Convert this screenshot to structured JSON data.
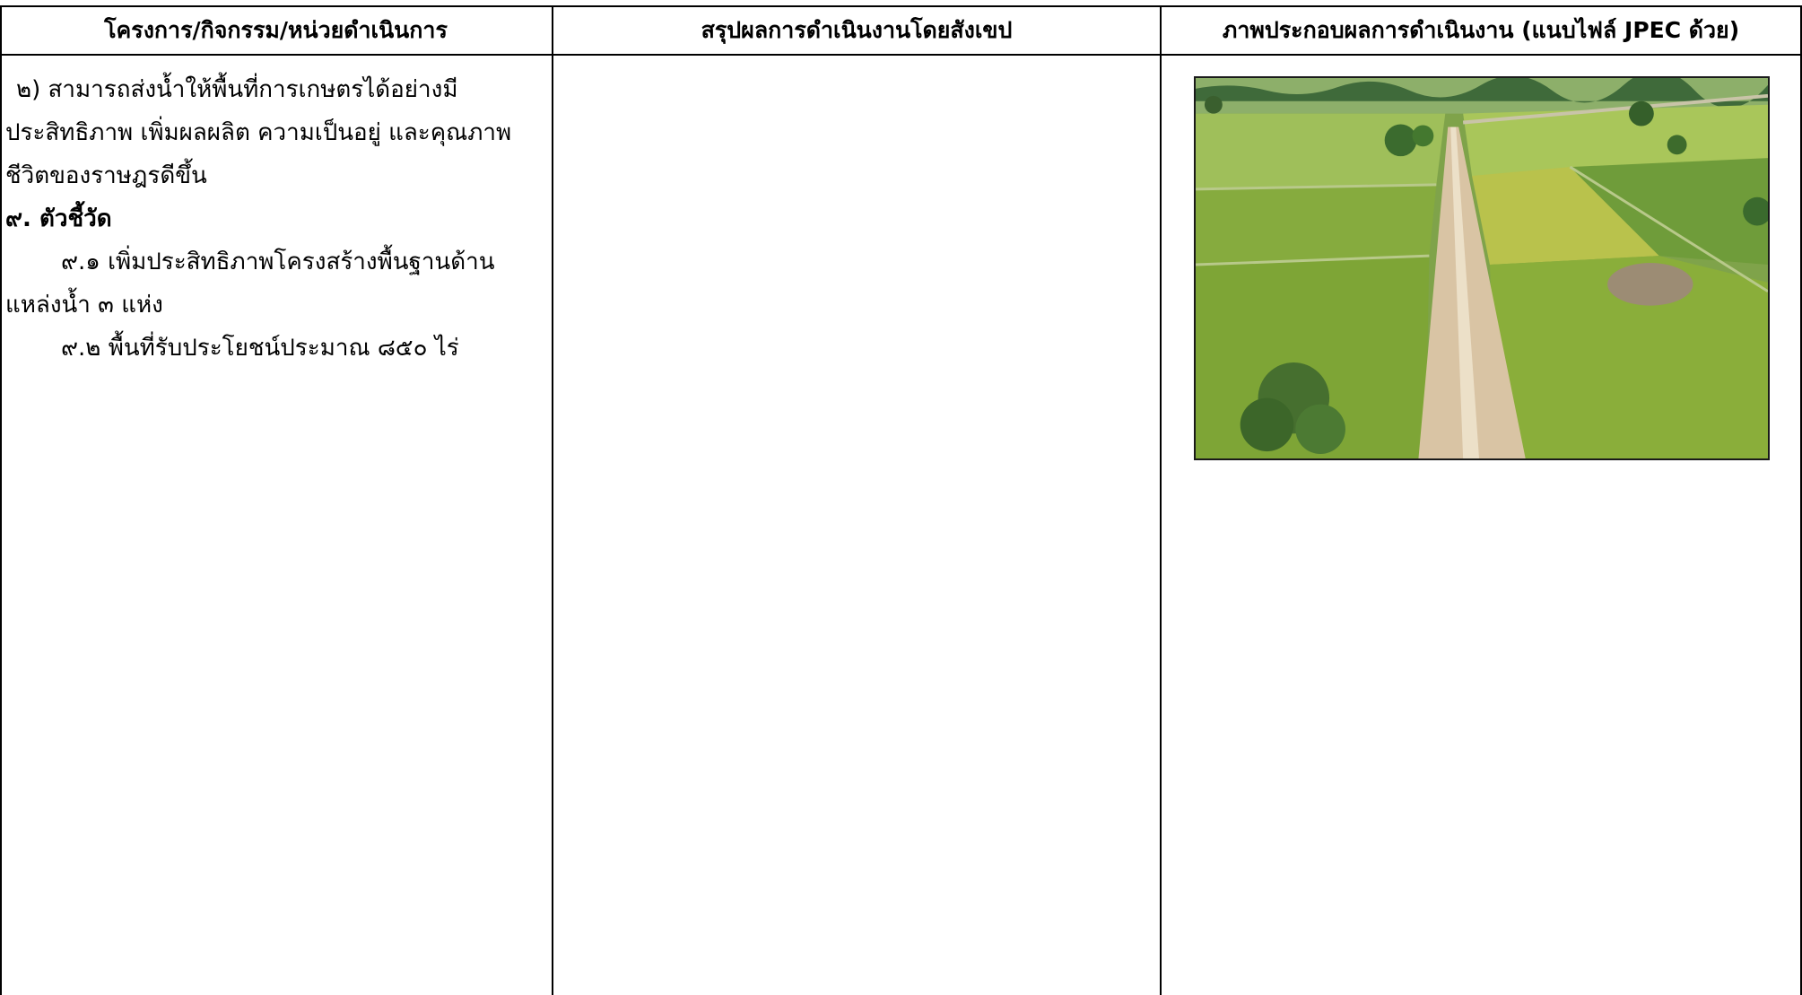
{
  "table": {
    "headers": [
      "โครงการ/กิจกรรม/หน่วยดำเนินการ",
      "สรุปผลการดำเนินงานโดยสังเขป",
      "ภาพประกอบผลการดำเนินงาน (แนบไฟล์ JPEC ด้วย)"
    ],
    "column1": {
      "line1": "๒) สามารถส่งน้ำให้พื้นที่การเกษตรได้อย่างมี",
      "line2": "ประสิทธิภาพ เพิ่มผลผลิต ความเป็นอยู่ และคุณภาพ",
      "line3": "ชีวิตของราษฎรดีขึ้น",
      "heading": "๙. ตัวชี้วัด",
      "item1_a": "๙.๑ เพิ่มประสิทธิภาพโครงสร้างพื้นฐานด้าน",
      "item1_b": "แหล่งน้ำ ๓ แห่ง",
      "item2": "๙.๒ พื้นที่รับประโยชน์ประมาณ ๘๕๐ ไร่"
    },
    "column2": {},
    "column3": {
      "image": "aerial-photo-rice-fields-dirt-road"
    }
  }
}
